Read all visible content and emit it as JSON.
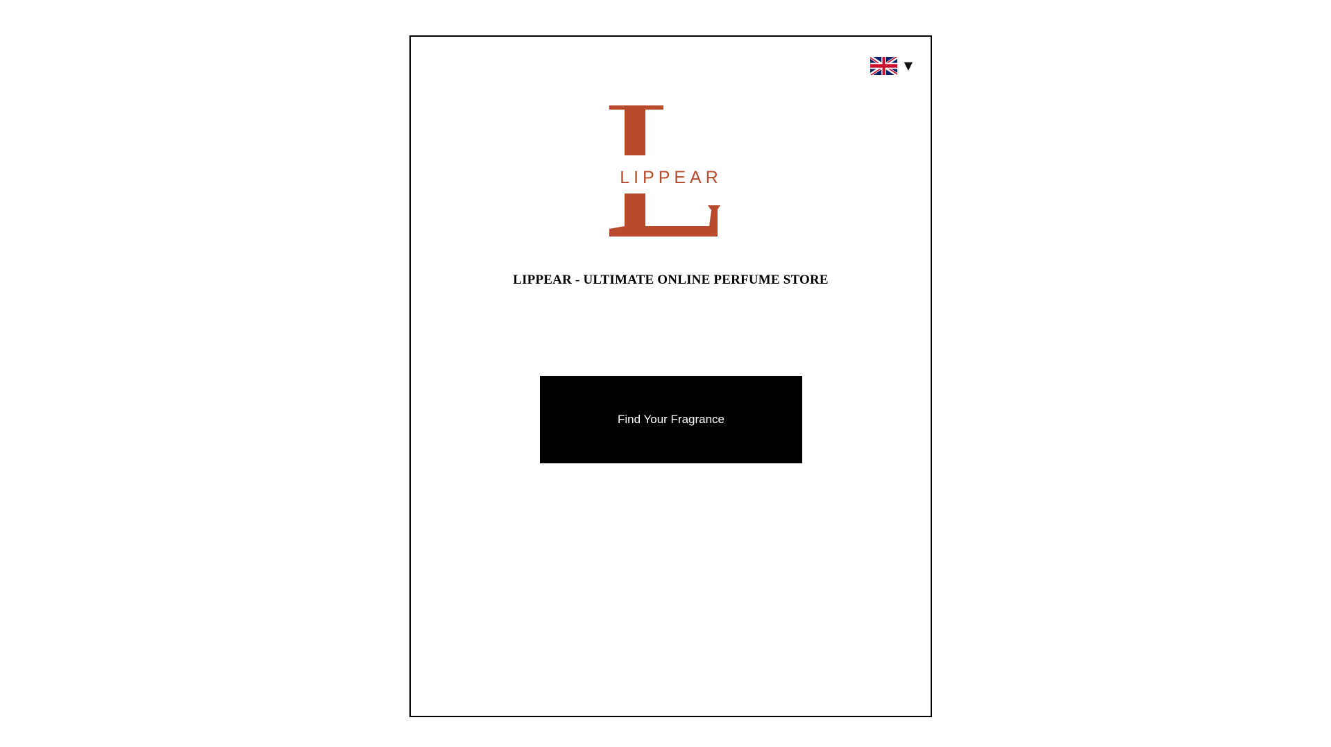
{
  "language_selector": {
    "flag_icon": "uk-flag-icon",
    "chevron_icon": "triangle-down-icon",
    "chevron_glyph": "▼"
  },
  "logo": {
    "letter": "L",
    "wordmark": "LIPPEAR",
    "color": "#B94A2C"
  },
  "title": "LIPPEAR - ULTIMATE ONLINE PERFUME STORE",
  "cta": {
    "label": "Find Your Fragrance",
    "background": "#000000",
    "text_color": "#FFFFFF"
  }
}
